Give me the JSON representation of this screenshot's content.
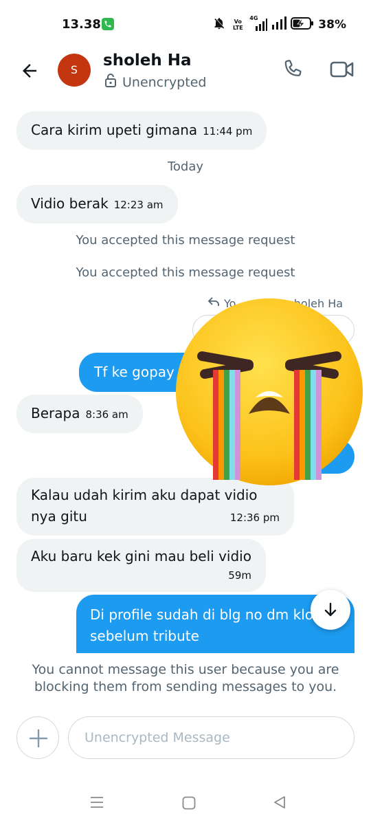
{
  "status_bar": {
    "time": "13.38",
    "network_label": "Vo LTE",
    "network_type": "4G",
    "battery_percent": "38%",
    "icons": [
      "phone-call-notification-icon",
      "bell-off-icon",
      "volte-icon",
      "signal-icon",
      "signal-icon",
      "battery-charging-icon"
    ]
  },
  "header": {
    "avatar_initial": "S",
    "avatar_color": "#c4360f",
    "contact_name": "sholeh Ha",
    "encryption_status": "Unencrypted"
  },
  "messages": [
    {
      "direction": "in",
      "text": "Cara kirim upeti gimana",
      "time": "11:44 pm"
    },
    {
      "type": "separator",
      "text": "Today"
    },
    {
      "direction": "in",
      "text": "Vidio berak",
      "time": "12:23 am"
    },
    {
      "type": "system",
      "text": "You accepted this message request"
    },
    {
      "type": "system",
      "text": "You accepted this message request"
    },
    {
      "type": "reply_header",
      "text_start": "Yo",
      "text_end": "sholeh Ha"
    },
    {
      "direction": "out",
      "text": "Tf ke gopay",
      "time": ""
    },
    {
      "direction": "in",
      "text": "Berapa",
      "time": "8:36 am"
    },
    {
      "direction": "in",
      "text_line1": "Kalau udah kirim aku dapat vidio",
      "text_line2": "nya gitu",
      "time": "12:36 pm"
    },
    {
      "direction": "in",
      "text": "Aku baru kek gini mau beli vidio",
      "time": "59m"
    },
    {
      "direction": "out",
      "text_line1": "Di profile sudah di blg no dm klo",
      "text_line2": "sebelum tribute"
    }
  ],
  "sticker": {
    "name": "loudly-crying-face-rainbow-tears"
  },
  "blocked_notice": "You cannot message this user because you are blocking them from sending messages to you.",
  "composer": {
    "placeholder": "Unencrypted Message"
  },
  "colors": {
    "accent": "#1d9bf0",
    "incoming_bubble": "#eff3f4",
    "muted_text": "#536471"
  }
}
